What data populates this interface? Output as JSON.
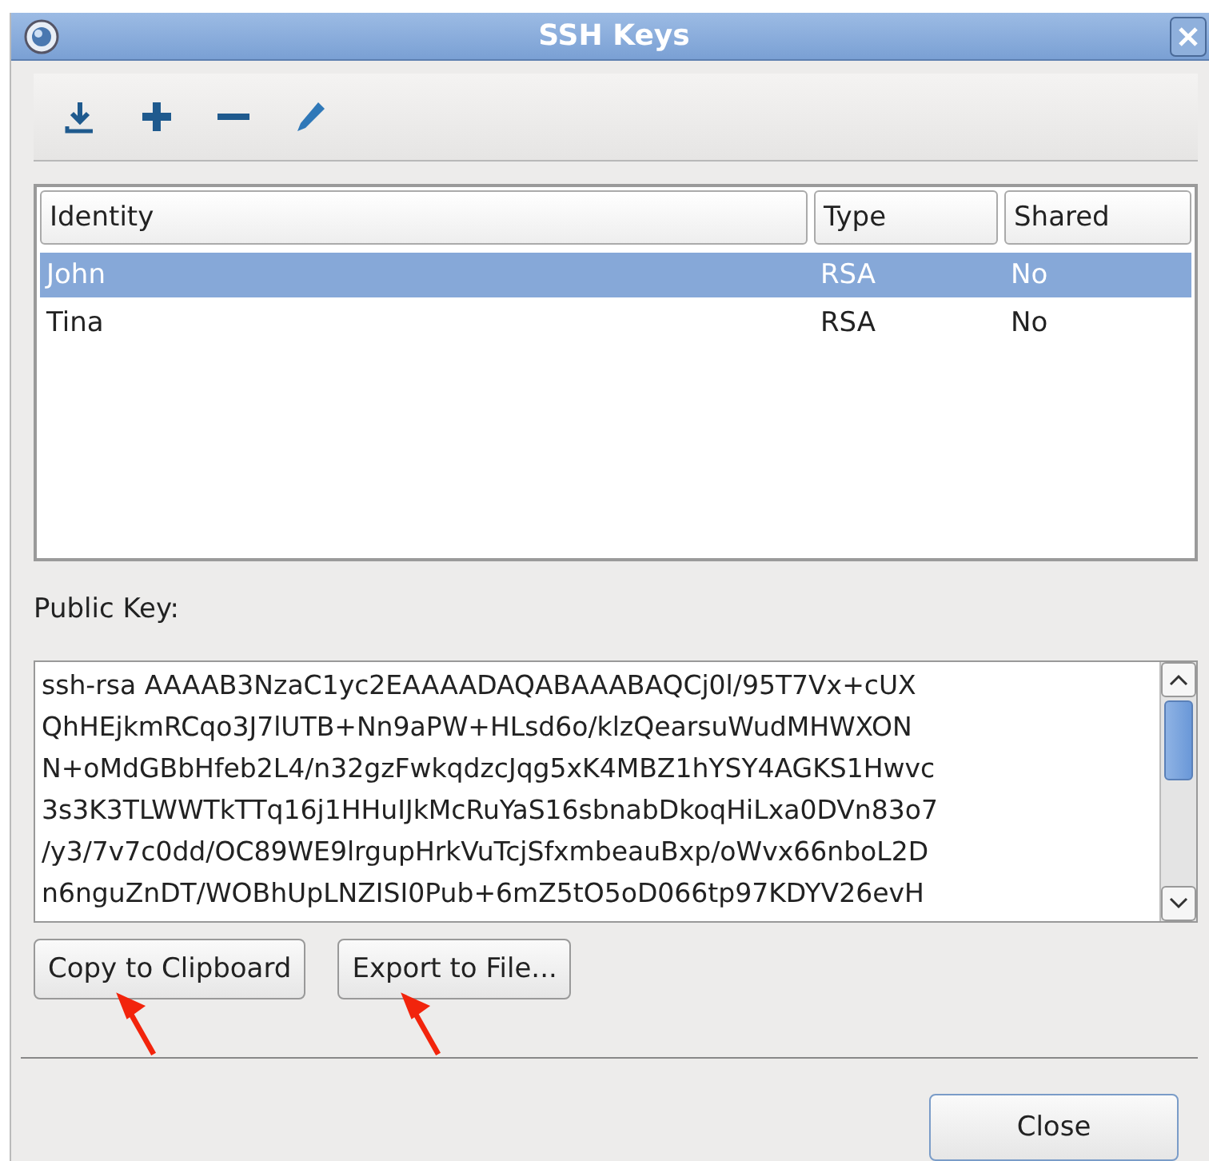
{
  "window": {
    "title": "SSH Keys"
  },
  "toolbar": [
    {
      "kind": "import"
    },
    {
      "kind": "add"
    },
    {
      "kind": "remove"
    },
    {
      "kind": "edit"
    }
  ],
  "table": {
    "columns": [
      "Identity",
      "Type",
      "Shared"
    ],
    "rows": [
      {
        "cells": [
          "John",
          "RSA",
          "No"
        ],
        "selected": true
      },
      {
        "cells": [
          "Tina",
          "RSA",
          "No"
        ],
        "selected": false
      }
    ]
  },
  "public_key": {
    "label": "Public Key:",
    "lines": [
      "ssh-rsa AAAAB3NzaC1yc2EAAAADAQABAAABAQCj0l/95T7Vx+cUX",
      "QhHEjkmRCqo3J7lUTB+Nn9aPW+HLsd6o/klzQearsuWudMHWXON",
      "N+oMdGBbHfeb2L4/n32gzFwkqdzcJqg5xK4MBZ1hYSY4AGKS1Hwvc",
      "3s3K3TLWWTkTTq16j1HHuIJkMcRuYaS16sbnabDkoqHiLxa0DVn83o7",
      "/y3/7v7c0dd/OC89WE9lrgupHrkVuTcjSfxmbeauBxp/oWvx66nboL2D",
      "n6nguZnDT/WOBhUpLNZISI0Pub+6mZ5tO5oD066tp97KDYV26evH"
    ]
  },
  "key_buttons": [
    "Copy to Clipboard",
    "Export to File..."
  ],
  "close_button": "Close"
}
